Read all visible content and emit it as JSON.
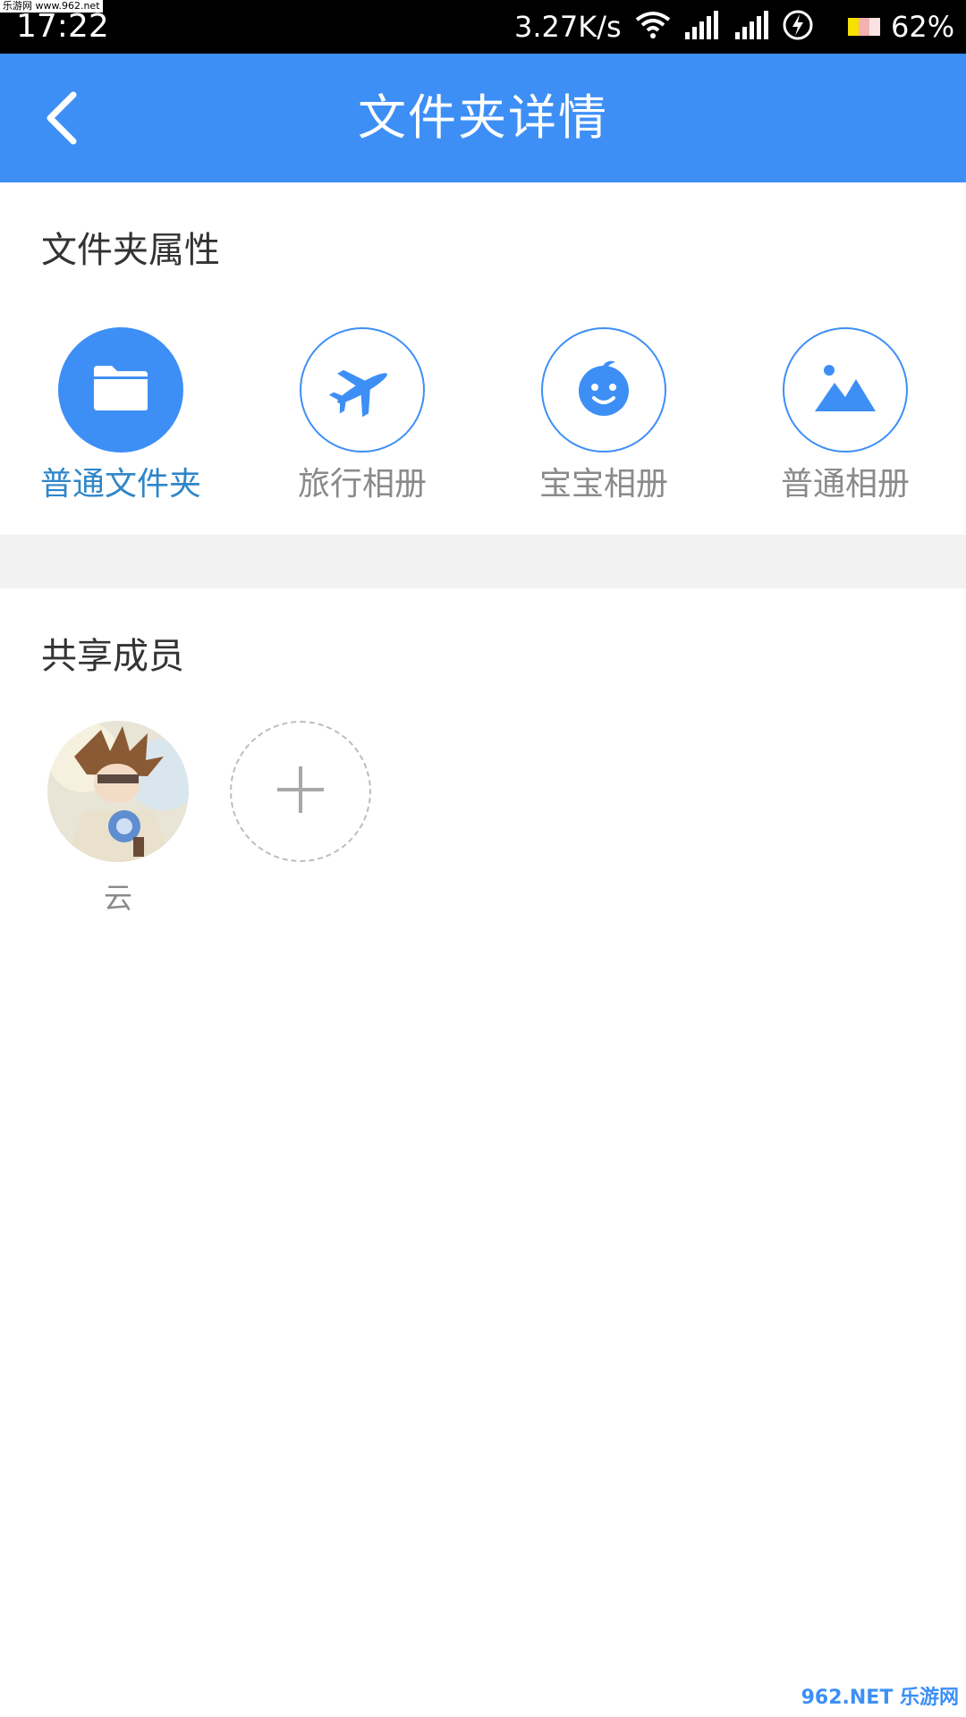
{
  "status_bar": {
    "watermark": "乐游网 www.962.net",
    "time": "17:22",
    "speed": "3.27K/s",
    "battery": "62%"
  },
  "header": {
    "title": "文件夹详情"
  },
  "attributes": {
    "title": "文件夹属性",
    "items": [
      {
        "label": "普通文件夹",
        "icon": "folder-icon",
        "selected": true
      },
      {
        "label": "旅行相册",
        "icon": "airplane-icon",
        "selected": false
      },
      {
        "label": "宝宝相册",
        "icon": "baby-face-icon",
        "selected": false
      },
      {
        "label": "普通相册",
        "icon": "landscape-icon",
        "selected": false
      }
    ]
  },
  "members": {
    "title": "共享成员",
    "list": [
      {
        "name": "云"
      }
    ]
  },
  "corner_watermark": "962.NET 乐游网",
  "colors": {
    "accent": "#3d8ff6",
    "selected_label": "#2f86c8",
    "muted_text": "#8a8a8a",
    "band": "#f2f2f2"
  }
}
